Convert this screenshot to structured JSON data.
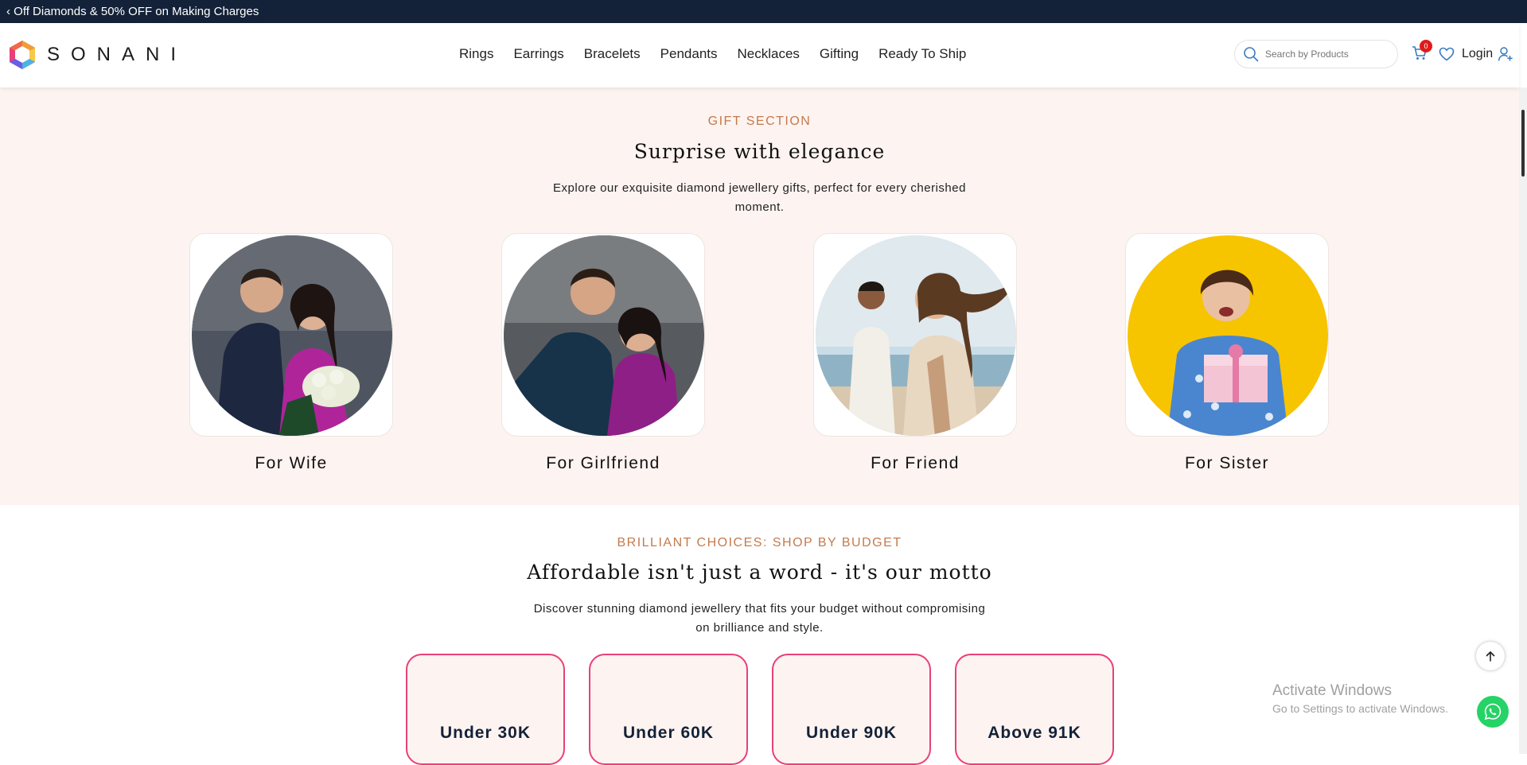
{
  "promo": {
    "text": "‹ Off Diamonds & 50% OFF on Making Charges"
  },
  "header": {
    "brand": "SONANI",
    "nav": [
      "Rings",
      "Earrings",
      "Bracelets",
      "Pendants",
      "Necklaces",
      "Gifting",
      "Ready To Ship"
    ],
    "search_placeholder": "Search by Products",
    "cart_count": "0",
    "login_label": "Login"
  },
  "gift": {
    "eyebrow": "GIFT SECTION",
    "heading": "Surprise with elegance",
    "sub": "Explore our exquisite diamond jewellery gifts, perfect for every cherished moment.",
    "cards": [
      {
        "label": "For Wife"
      },
      {
        "label": "For Girlfriend"
      },
      {
        "label": "For Friend"
      },
      {
        "label": "For Sister"
      }
    ]
  },
  "budget": {
    "eyebrow": "BRILLIANT CHOICES: SHOP BY BUDGET",
    "heading": "Affordable isn't just a word - it's our motto",
    "sub": "Discover stunning diamond jewellery that fits your budget without compromising on brilliance and style.",
    "cards": [
      "Under 30K",
      "Under 60K",
      "Under 90K",
      "Above 91K"
    ]
  },
  "watermark": {
    "line1": "Activate Windows",
    "line2": "Go to Settings to activate Windows."
  },
  "colors": {
    "promo_bg": "#132238",
    "accent": "#c47a4e",
    "gift_bg": "#fdf3f0",
    "budget_border": "#e8407a",
    "badge": "#e01b1b",
    "whatsapp": "#25d366"
  }
}
